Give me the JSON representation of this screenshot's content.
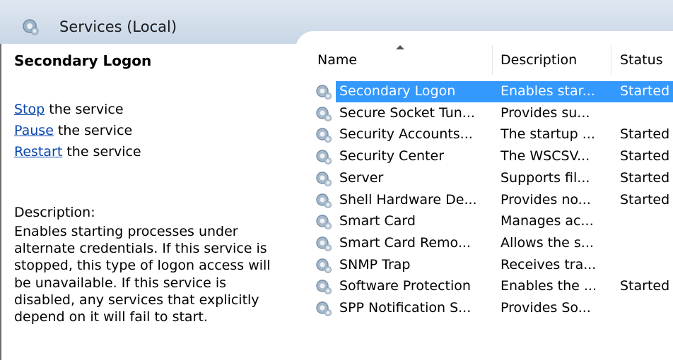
{
  "window": {
    "title": "Services (Local)",
    "icon": "services-gear-icon"
  },
  "left_pane": {
    "service_name": "Secondary Logon",
    "actions": [
      {
        "link": "Stop",
        "rest": " the service"
      },
      {
        "link": "Pause",
        "rest": " the service"
      },
      {
        "link": "Restart",
        "rest": " the service"
      }
    ],
    "description_label": "Description:",
    "description": "Enables starting processes under alternate credentials. If this service is stopped, this type of logon access will be unavailable. If this service is disabled, any services that explicitly depend on it will fail to start."
  },
  "list": {
    "columns": [
      "Name",
      "Description",
      "Status"
    ],
    "sorted_column": "Name",
    "rows": [
      {
        "name": "Secondary Logon",
        "description": "Enables star...",
        "status": "Started",
        "selected": true
      },
      {
        "name": "Secure Socket Tun...",
        "description": "Provides su...",
        "status": ""
      },
      {
        "name": "Security Accounts...",
        "description": "The startup ...",
        "status": "Started"
      },
      {
        "name": "Security Center",
        "description": "The WSCSV...",
        "status": "Started"
      },
      {
        "name": "Server",
        "description": "Supports fil...",
        "status": "Started"
      },
      {
        "name": "Shell Hardware De...",
        "description": "Provides no...",
        "status": "Started"
      },
      {
        "name": "Smart Card",
        "description": "Manages ac...",
        "status": ""
      },
      {
        "name": "Smart Card Remo...",
        "description": "Allows the s...",
        "status": ""
      },
      {
        "name": "SNMP Trap",
        "description": "Receives tra...",
        "status": ""
      },
      {
        "name": "Software Protection",
        "description": "Enables the ...",
        "status": "Started"
      },
      {
        "name": "SPP Notification S...",
        "description": "Provides So...",
        "status": ""
      }
    ]
  },
  "colors": {
    "selection": "#3399ff",
    "link": "#0645ad",
    "header_bg": "#c9d6e6"
  }
}
